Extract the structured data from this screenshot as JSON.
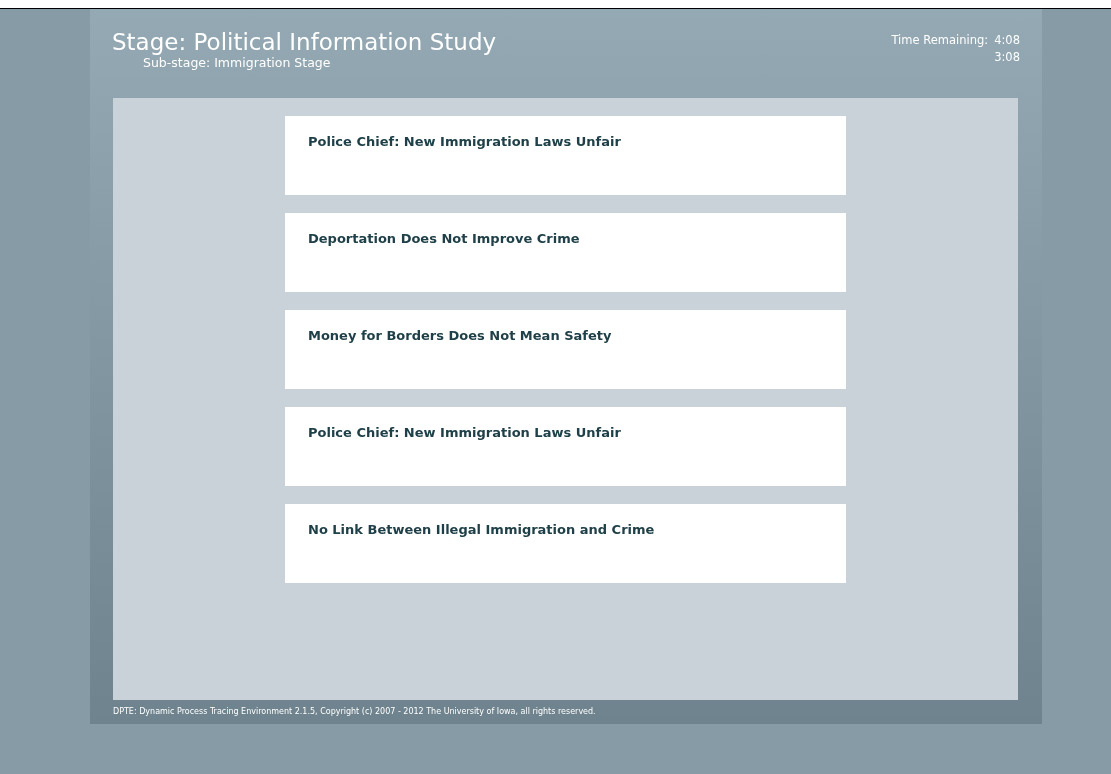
{
  "header": {
    "title": "Stage: Political Information Study",
    "subtitle": "Sub-stage: Immigration Stage",
    "time_label": "Time Remaining:",
    "times": [
      "4:08",
      "3:08"
    ]
  },
  "headlines": [
    {
      "text": "Police Chief: New Immigration Laws Unfair"
    },
    {
      "text": "Deportation Does Not Improve Crime"
    },
    {
      "text": "Money for Borders Does Not Mean Safety"
    },
    {
      "text": "Police Chief: New Immigration Laws Unfair"
    },
    {
      "text": "No Link Between Illegal Immigration and Crime"
    }
  ],
  "footer": "DPTE:  Dynamic Process Tracing Environment 2.1.5, Copyright (c) 2007 - 2012 The University of Iowa, all rights reserved."
}
